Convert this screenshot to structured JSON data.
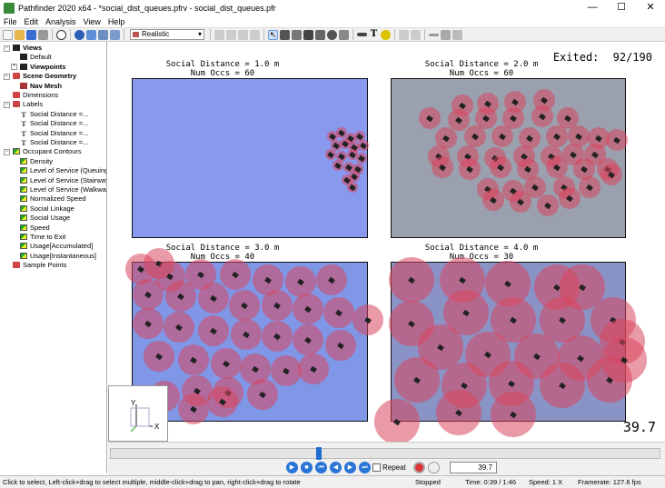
{
  "window": {
    "title": "Pathfinder 2020 x64 - *social_dist_queues.pfrv - social_dist_queues.pfr",
    "controls": [
      "—",
      "☐",
      "✕"
    ]
  },
  "menu": [
    "File",
    "Edit",
    "Analysis",
    "View",
    "Help"
  ],
  "toolbar": {
    "render_mode": "Realistic"
  },
  "tree": [
    {
      "label": "Views",
      "bold": true,
      "icon": "views-icon"
    },
    {
      "label": "Default",
      "bold": false,
      "icon": "view-icon"
    },
    {
      "label": "Viewpoints",
      "bold": true,
      "icon": "viewpoints-icon"
    },
    {
      "label": "Scene Geometry",
      "bold": true,
      "icon": "geometry-icon"
    },
    {
      "label": "Nav Mesh",
      "bold": true,
      "icon": "navmesh-icon"
    },
    {
      "label": "Dimensions",
      "bold": false,
      "icon": "dimensions-icon"
    },
    {
      "label": "Labels",
      "bold": false,
      "icon": "labels-icon"
    },
    {
      "label": "Social Distance =...",
      "bold": false,
      "icon": "text-label-icon"
    },
    {
      "label": "Social Distance =...",
      "bold": false,
      "icon": "text-label-icon"
    },
    {
      "label": "Social Distance =...",
      "bold": false,
      "icon": "text-label-icon"
    },
    {
      "label": "Social Distance =...",
      "bold": false,
      "icon": "text-label-icon"
    },
    {
      "label": "Occupant Contours",
      "bold": false,
      "icon": "contour-icon"
    },
    {
      "label": "Density",
      "bold": false,
      "icon": "contour-icon"
    },
    {
      "label": "Level of Service (Queuing",
      "bold": false,
      "icon": "contour-icon"
    },
    {
      "label": "Level of Service (Stairway)",
      "bold": false,
      "icon": "contour-icon"
    },
    {
      "label": "Level of Service (Walkway",
      "bold": false,
      "icon": "contour-icon"
    },
    {
      "label": "Normalized Speed",
      "bold": false,
      "icon": "contour-icon"
    },
    {
      "label": "Social Linkage",
      "bold": false,
      "icon": "contour-icon"
    },
    {
      "label": "Social Usage",
      "bold": false,
      "icon": "contour-icon"
    },
    {
      "label": "Speed",
      "bold": false,
      "icon": "contour-icon"
    },
    {
      "label": "Time to Exit",
      "bold": false,
      "icon": "contour-icon"
    },
    {
      "label": "Usage[Accumulated]",
      "bold": false,
      "icon": "contour-icon"
    },
    {
      "label": "Usage[Instantaneous]",
      "bold": false,
      "icon": "contour-icon"
    },
    {
      "label": "Sample Points",
      "bold": false,
      "icon": "sample-points-icon"
    }
  ],
  "viewport": {
    "exited_label": "Exited:",
    "exited_value": "92/190",
    "time_display": "39.7",
    "rooms": [
      {
        "line1": "Social Distance = 1.0 m",
        "line2": "Num Occs = 60",
        "color": "#8899ee"
      },
      {
        "line1": "Social Distance = 2.0 m",
        "line2": "Num Occs = 60",
        "color": "#9aa0ae"
      },
      {
        "line1": "Social Distance = 3.0 m",
        "line2": "Num Occs = 40",
        "color": "#7f97e6"
      },
      {
        "line1": "Social Distance = 4.0 m",
        "line2": "Num Occs = 30",
        "color": "#8a93c6"
      }
    ],
    "axes": {
      "y": "Y",
      "x": "X"
    }
  },
  "playback": {
    "repeat_label": "Repeat",
    "time_value": "39.7",
    "progress": 0.378
  },
  "status": {
    "hint": "Click to select, Left-click+drag to select multiple, middle-click+drag to pan, right-click+drag to rotate",
    "state": "Stopped",
    "time": "Time: 0:39 / 1:46",
    "speed": "Speed: 1 X",
    "framerate": "Framerate: 127.6 fps"
  },
  "colors": {
    "occupant_disc": "#d8465f",
    "accent": "#2a74d6"
  }
}
